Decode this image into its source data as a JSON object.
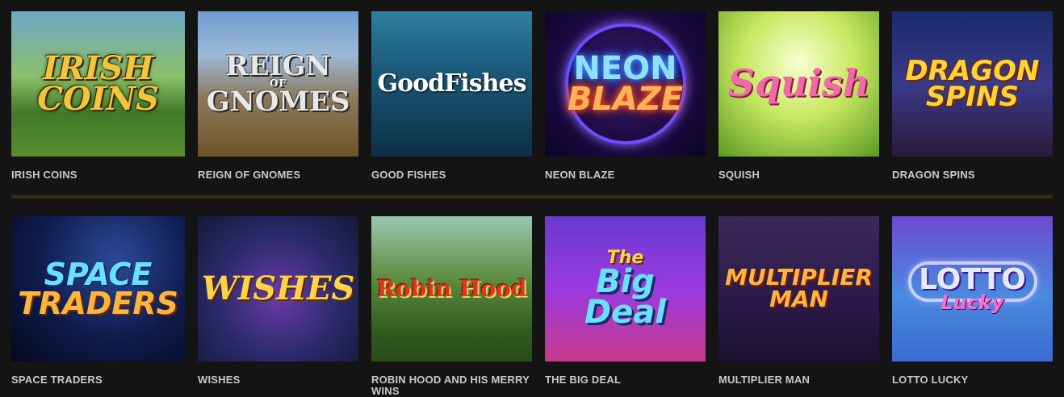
{
  "games": [
    {
      "caption": "IRISH COINS",
      "logo": [
        "IRISH",
        "COINS"
      ]
    },
    {
      "caption": "REIGN OF GNOMES",
      "logo": [
        "REIGN",
        "OF",
        "GNOMES"
      ]
    },
    {
      "caption": "GOOD FISHES",
      "logo": [
        "GoodFishes"
      ]
    },
    {
      "caption": "NEON BLAZE",
      "logo": [
        "NEON",
        "BLAZE"
      ]
    },
    {
      "caption": "SQUISH",
      "logo": [
        "Squish"
      ]
    },
    {
      "caption": "DRAGON SPINS",
      "logo": [
        "DRAGON",
        "SPINS"
      ]
    },
    {
      "caption": "SPACE TRADERS",
      "logo": [
        "SPACE",
        "TRADERS"
      ]
    },
    {
      "caption": "WISHES",
      "logo": [
        "WISHES"
      ]
    },
    {
      "caption": "ROBIN HOOD AND HIS MERRY WINS",
      "logo": [
        "Robin Hood"
      ]
    },
    {
      "caption": "THE BIG DEAL",
      "logo": [
        "The",
        "Big",
        "Deal"
      ]
    },
    {
      "caption": "MULTIPLIER MAN",
      "logo": [
        "MULTIPLIER",
        "MAN"
      ]
    },
    {
      "caption": "LOTTO LUCKY",
      "logo": [
        "LOTTO",
        "Lucky"
      ]
    }
  ],
  "colors": {
    "background": "#141414",
    "caption": "#c9c9c9",
    "divider": "#3a2c14"
  }
}
